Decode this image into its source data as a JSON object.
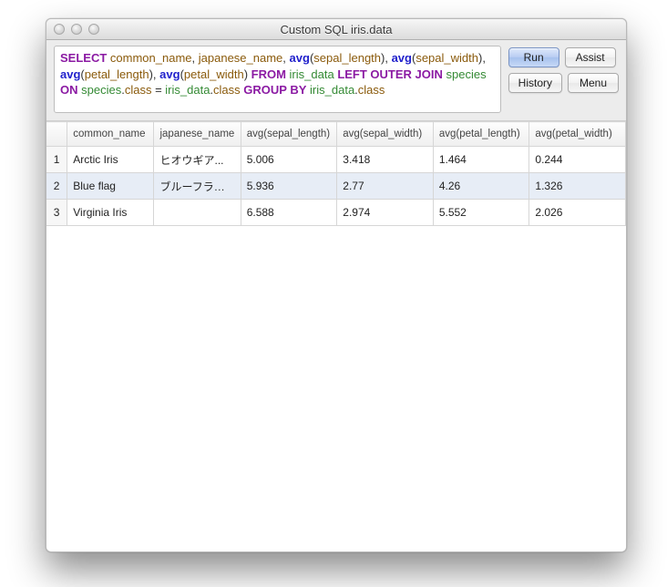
{
  "window": {
    "title": "Custom SQL iris.data"
  },
  "sql": {
    "tokens": [
      {
        "t": "SELECT",
        "c": "kw"
      },
      {
        "t": " "
      },
      {
        "t": "common_name",
        "c": "col"
      },
      {
        "t": ", "
      },
      {
        "t": "japanese_name",
        "c": "col"
      },
      {
        "t": ", "
      },
      {
        "t": "avg",
        "c": "fn"
      },
      {
        "t": "("
      },
      {
        "t": "sepal_length",
        "c": "col"
      },
      {
        "t": "), "
      },
      {
        "t": "avg",
        "c": "fn"
      },
      {
        "t": "("
      },
      {
        "t": "sepal_width",
        "c": "col"
      },
      {
        "t": "), "
      },
      {
        "t": "avg",
        "c": "fn"
      },
      {
        "t": "("
      },
      {
        "t": "petal_length",
        "c": "col"
      },
      {
        "t": "), "
      },
      {
        "t": "avg",
        "c": "fn"
      },
      {
        "t": "("
      },
      {
        "t": "petal_width",
        "c": "col"
      },
      {
        "t": ") "
      },
      {
        "t": "FROM",
        "c": "kw"
      },
      {
        "t": " "
      },
      {
        "t": "iris_data",
        "c": "tbl"
      },
      {
        "t": " "
      },
      {
        "t": "LEFT OUTER JOIN",
        "c": "kw"
      },
      {
        "t": " "
      },
      {
        "t": "species",
        "c": "tbl"
      },
      {
        "t": " "
      },
      {
        "t": "ON",
        "c": "kw"
      },
      {
        "t": " "
      },
      {
        "t": "species",
        "c": "tbl"
      },
      {
        "t": "."
      },
      {
        "t": "class",
        "c": "col"
      },
      {
        "t": " = "
      },
      {
        "t": "iris_data",
        "c": "tbl"
      },
      {
        "t": "."
      },
      {
        "t": "class",
        "c": "col"
      },
      {
        "t": " "
      },
      {
        "t": "GROUP BY",
        "c": "kw"
      },
      {
        "t": " "
      },
      {
        "t": "iris_data",
        "c": "tbl"
      },
      {
        "t": "."
      },
      {
        "t": "class",
        "c": "col"
      }
    ]
  },
  "buttons": {
    "run": "Run",
    "assist": "Assist",
    "history": "History",
    "menu": "Menu"
  },
  "table": {
    "headers": [
      "",
      "common_name",
      "japanese_name",
      "avg(sepal_length)",
      "avg(sepal_width)",
      "avg(petal_length)",
      "avg(petal_width)"
    ],
    "rows": [
      {
        "n": "1",
        "common_name": "Arctic Iris",
        "japanese_name": "ヒオウギア...",
        "sl": "5.006",
        "sw": "3.418",
        "pl": "1.464",
        "pw": "0.244",
        "selected": false
      },
      {
        "n": "2",
        "common_name": "Blue flag",
        "japanese_name": "ブルーフラッグ",
        "sl": "5.936",
        "sw": "2.77",
        "pl": "4.26",
        "pw": "1.326",
        "selected": true
      },
      {
        "n": "3",
        "common_name": "Virginia Iris",
        "japanese_name": "",
        "sl": "6.588",
        "sw": "2.974",
        "pl": "5.552",
        "pw": "2.026",
        "selected": false
      }
    ]
  }
}
